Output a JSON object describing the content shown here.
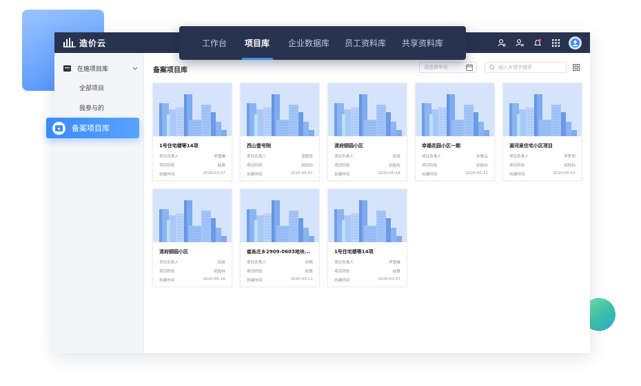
{
  "app": {
    "logo_text": "造价云"
  },
  "topnav": {
    "items": [
      {
        "label": "工作台",
        "active": false
      },
      {
        "label": "项目库",
        "active": true
      },
      {
        "label": "企业数据库",
        "active": false
      },
      {
        "label": "员工资料库",
        "active": false
      },
      {
        "label": "共享资料库",
        "active": false
      }
    ]
  },
  "sidebar": {
    "group_label": "在施项目库",
    "items": [
      "全部项目",
      "我参与的"
    ],
    "active_label": "备案项目库"
  },
  "main": {
    "title": "备案项目库",
    "year_placeholder": "请选择年份",
    "search_placeholder": "输入关键字搜索"
  },
  "card_fields": {
    "manager": "项目负责人",
    "stage": "项目阶段",
    "created": "创建时间"
  },
  "projects": [
    {
      "name": "1号住宅楼等14项",
      "manager": "李雪峰",
      "stage": "结算",
      "created": "2020-03-07"
    },
    {
      "name": "西山壹号院",
      "manager": "张朝其",
      "stage": "招投标",
      "created": "2020-06-01"
    },
    {
      "name": "清府颐园小区",
      "manager": "田英",
      "stage": "招投标",
      "created": "2020-05-16"
    },
    {
      "name": "幸福花园小区一期",
      "manager": "刘青云",
      "stage": "招投标",
      "created": "2020-05-11"
    },
    {
      "name": "源河泉住宅小区项目",
      "manager": "李梦莉",
      "stage": "招投标",
      "created": "2020-05-02"
    },
    {
      "name": "清府颐园小区",
      "manager": "田英",
      "stage": "招投标",
      "created": "2020-05-16"
    },
    {
      "name": "崔各庄乡2909-0603地块...",
      "manager": "刘萌",
      "stage": "结算",
      "created": "2020-03-11"
    },
    {
      "name": "1号住宅楼等14项",
      "manager": "李雪峰",
      "stage": "结算",
      "created": "2020-03-07"
    }
  ],
  "colors": {
    "nav_bg": "#28334f",
    "accent": "#3d8bff",
    "thumb_bg": "#d5e4fb"
  }
}
